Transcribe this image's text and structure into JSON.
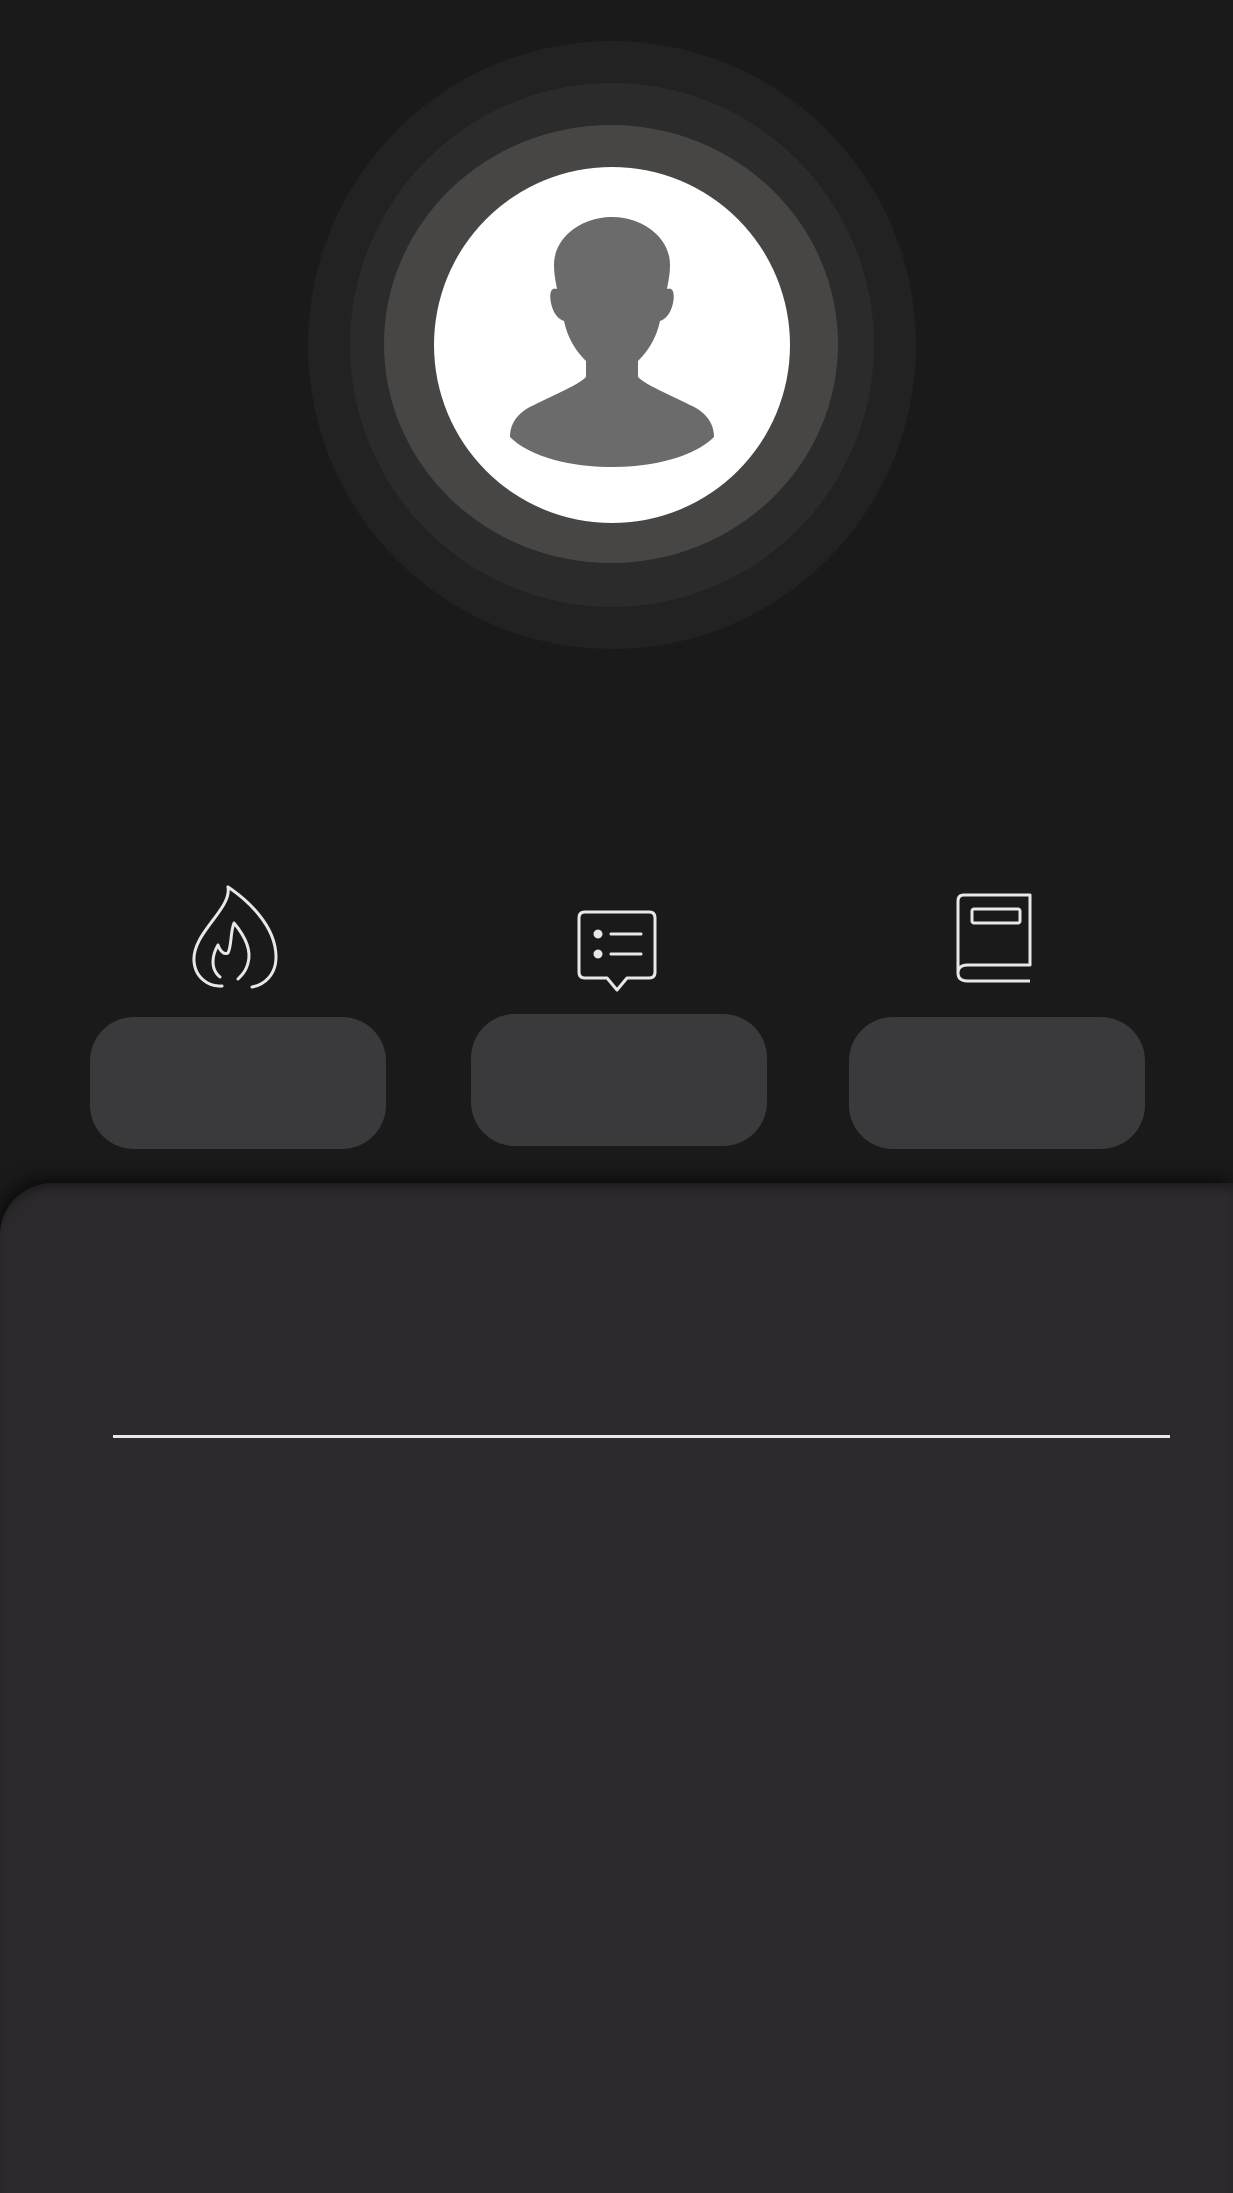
{
  "profile": {
    "avatar_icon": "user-silhouette-icon"
  },
  "actions": [
    {
      "icon": "flame-icon",
      "label": ""
    },
    {
      "icon": "list-message-icon",
      "label": ""
    },
    {
      "icon": "book-icon",
      "label": ""
    }
  ],
  "colors": {
    "background": "#1a1a1a",
    "panel": "#2c2a2d",
    "button": "#3a393b",
    "avatar_fill": "#ffffff",
    "silhouette": "#6b6b6b"
  }
}
